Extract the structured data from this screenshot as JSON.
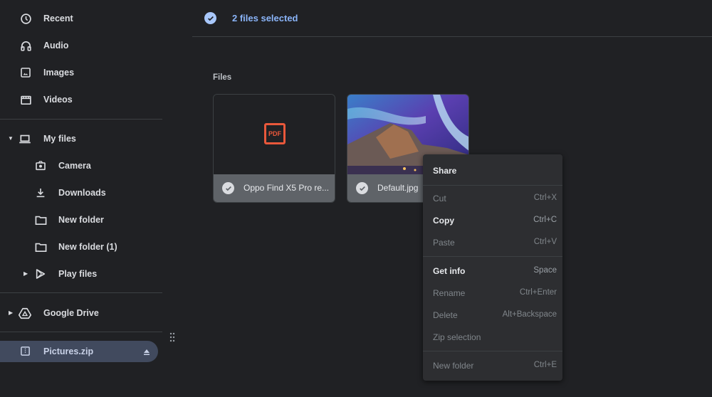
{
  "sidebar": {
    "items": [
      {
        "label": "Recent",
        "icon": "clock-icon"
      },
      {
        "label": "Audio",
        "icon": "headphones-icon"
      },
      {
        "label": "Images",
        "icon": "image-icon"
      },
      {
        "label": "Videos",
        "icon": "video-icon"
      },
      {
        "label": "My files",
        "icon": "laptop-icon"
      },
      {
        "label": "Camera",
        "icon": "camera-icon"
      },
      {
        "label": "Downloads",
        "icon": "download-icon"
      },
      {
        "label": "New folder",
        "icon": "folder-icon"
      },
      {
        "label": "New folder (1)",
        "icon": "folder-icon"
      },
      {
        "label": "Play files",
        "icon": "play-store-icon"
      },
      {
        "label": "Google Drive",
        "icon": "drive-icon"
      },
      {
        "label": "Pictures.zip",
        "icon": "archive-icon"
      }
    ]
  },
  "header": {
    "selection_text": "2 files selected"
  },
  "main": {
    "section_label": "Files",
    "files": [
      {
        "name": "Oppo Find X5 Pro re...",
        "type": "pdf",
        "badge": "PDF",
        "selected": true
      },
      {
        "name": "Default.jpg",
        "type": "image",
        "selected": true
      }
    ]
  },
  "context_menu": {
    "items": [
      {
        "label": "Share",
        "shortcut": "",
        "enabled": true
      },
      {
        "label": "Cut",
        "shortcut": "Ctrl+X",
        "enabled": false
      },
      {
        "label": "Copy",
        "shortcut": "Ctrl+C",
        "enabled": true
      },
      {
        "label": "Paste",
        "shortcut": "Ctrl+V",
        "enabled": false
      },
      {
        "label": "Get info",
        "shortcut": "Space",
        "enabled": true
      },
      {
        "label": "Rename",
        "shortcut": "Ctrl+Enter",
        "enabled": false
      },
      {
        "label": "Delete",
        "shortcut": "Alt+Backspace",
        "enabled": false
      },
      {
        "label": "Zip selection",
        "shortcut": "",
        "enabled": false
      },
      {
        "label": "New folder",
        "shortcut": "Ctrl+E",
        "enabled": false
      }
    ]
  },
  "colors": {
    "accent": "#8ab4f8",
    "selected_nav_bg": "#414a5e",
    "pdf_red": "#e9583b"
  }
}
